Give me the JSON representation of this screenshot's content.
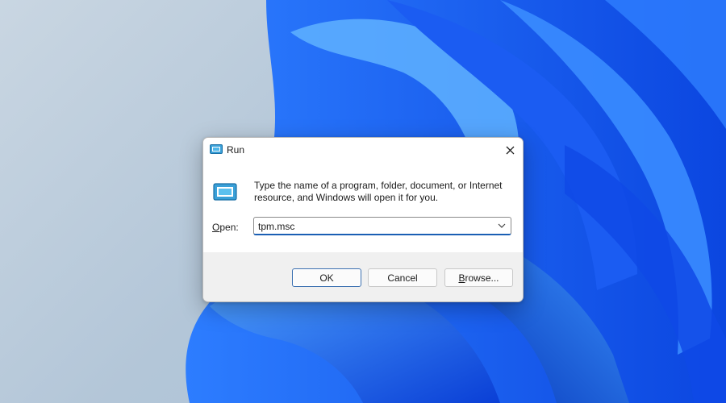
{
  "window": {
    "title": "Run",
    "close_icon": "close-icon",
    "app_icon": "run-icon"
  },
  "dialog": {
    "description": "Type the name of a program, folder, document, or Internet resource, and Windows will open it for you.",
    "open_label_prefix": "",
    "open_label_accel": "O",
    "open_label_rest": "pen:",
    "open_value": "tpm.msc"
  },
  "buttons": {
    "ok": "OK",
    "cancel": "Cancel",
    "browse_accel": "B",
    "browse_rest": "rowse..."
  },
  "colors": {
    "accent": "#1a5fb4",
    "wallpaper_blue": "#1f6bff"
  }
}
